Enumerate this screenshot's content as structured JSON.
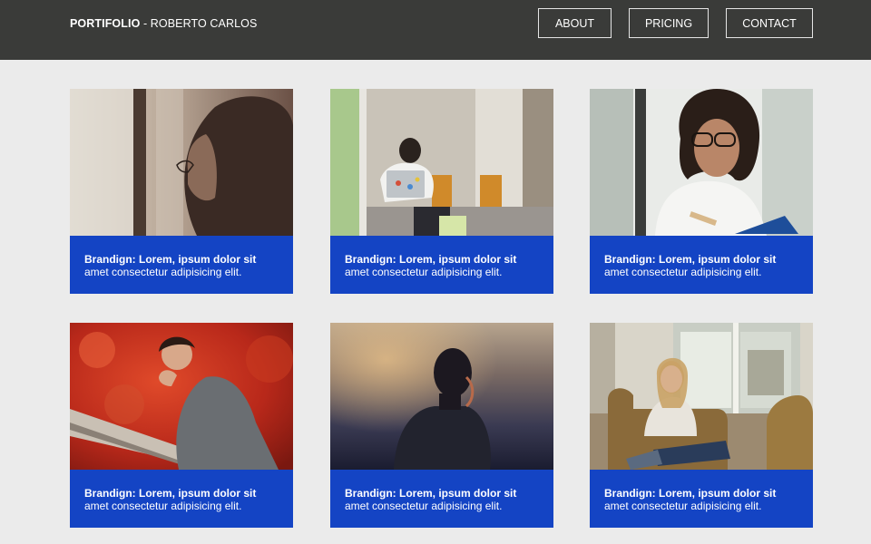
{
  "header": {
    "brand_bold": "PORTIFOLIO",
    "brand_rest": " - ROBERTO CARLOS",
    "nav": [
      "ABOUT",
      "PRICING",
      "CONTACT"
    ]
  },
  "cards": [
    {
      "title": "Brandign: Lorem, ipsum dolor sit",
      "body": "amet consectetur adipisicing elit."
    },
    {
      "title": "Brandign: Lorem, ipsum dolor sit",
      "body": "amet consectetur adipisicing elit."
    },
    {
      "title": "Brandign: Lorem, ipsum dolor sit",
      "body": "amet consectetur adipisicing elit."
    },
    {
      "title": "Brandign: Lorem, ipsum dolor sit",
      "body": "amet consectetur adipisicing elit."
    },
    {
      "title": "Brandign: Lorem, ipsum dolor sit",
      "body": "amet consectetur adipisicing elit."
    },
    {
      "title": "Brandign: Lorem, ipsum dolor sit",
      "body": "amet consectetur adipisicing elit."
    }
  ],
  "colors": {
    "header_bg": "#3a3b39",
    "page_bg": "#ebebeb",
    "card_caption_bg": "#1444c4"
  },
  "images": [
    "woman-profile-window-photo",
    "man-laptop-office-photo",
    "woman-glasses-reading-photo",
    "woman-red-leaves-photo",
    "woman-silhouette-sunset-photo",
    "woman-armchair-window-photo"
  ]
}
